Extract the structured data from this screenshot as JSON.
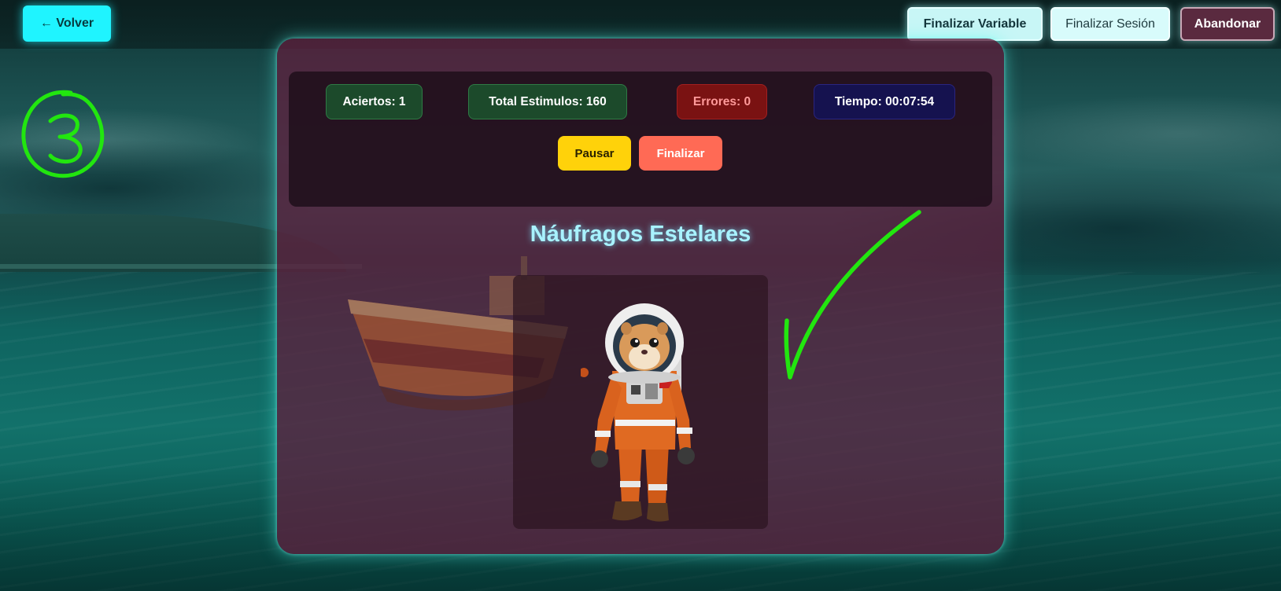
{
  "topbar": {
    "back_label": "← Volver",
    "finish_variable_label": "Finalizar Variable",
    "finish_session_label": "Finalizar Sesión",
    "abandon_label": "Abandonar"
  },
  "stats": {
    "hits": "Aciertos: 1",
    "total_stimuli": "Total Estimulos: 160",
    "errors": "Errores: 0",
    "time": "Tiempo: 00:07:54"
  },
  "controls": {
    "pause_label": "Pausar",
    "finish_label": "Finalizar"
  },
  "game": {
    "title": "Náufragos Estelares",
    "stimulus_image": "hamster-astronaut",
    "faded_background_object": "ship"
  },
  "annotations": {
    "circled_number": "3",
    "mark": "checkmark",
    "ink_color": "#22e60f"
  },
  "colors": {
    "back_button": "#1ff4ff",
    "card": "#5c203e",
    "title": "#a8f2ff",
    "hits_pill": "#1c4a2b",
    "errors_pill": "#7a1212",
    "time_pill": "#15124f",
    "pause_button": "#ffd20a",
    "finish_button": "#ff6a55"
  }
}
